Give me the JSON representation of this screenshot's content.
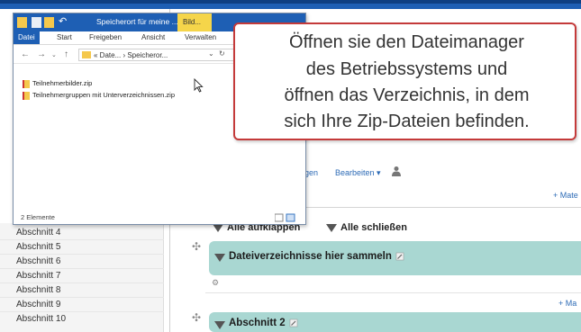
{
  "explorer": {
    "title": "Speicherort für meine ...",
    "context_tab": "Bild...",
    "ribbon_tabs": [
      "Datei",
      "Start",
      "Freigeben",
      "Ansicht",
      "Verwalten"
    ],
    "address": "« Date... › Speicheror...",
    "files": [
      "Teilnehmerbilder.zip",
      "Teilnehmergruppen mit Unterverzeichnissen.zip"
    ],
    "status": "2 Elemente"
  },
  "callout": {
    "lines": [
      "Öffnen sie den Dateimanager",
      "des Betriebssystems und",
      "öffnen das Verzeichnis, in dem",
      "sich Ihre Zip-Dateien befinden."
    ]
  },
  "nav": {
    "items": [
      "Abschnitt 4",
      "Abschnitt 5",
      "Abschnitt 6",
      "Abschnitt 7",
      "Abschnitt 8",
      "Abschnitt 9",
      "Abschnitt 10"
    ]
  },
  "course": {
    "breadcrumb_tail": "gen",
    "edit_menu": "Bearbeiten ▾",
    "add_link": "+ Mate",
    "add_link_2": "+ Ma",
    "expand_all": "Alle aufklappen",
    "collapse_all": "Alle schließen",
    "section1_title": "Dateiverzeichnisse hier sammeln",
    "section2_title": "Abschnitt 2"
  }
}
